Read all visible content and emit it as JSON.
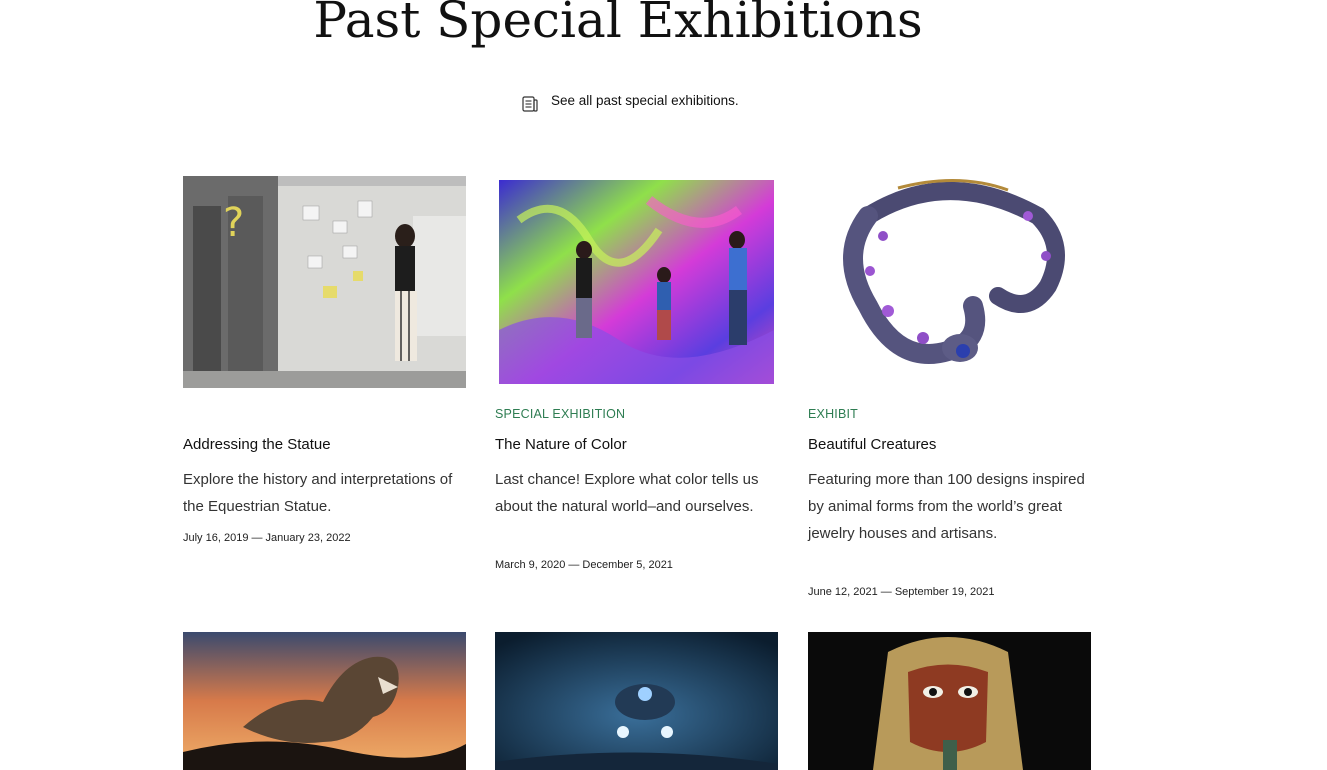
{
  "page": {
    "title": "Past Special Exhibitions"
  },
  "link": {
    "icon": "document-icon",
    "label": "See all past special exhibitions."
  },
  "cards": [
    {
      "tag": "",
      "title": "Addressing the Statue",
      "description": "Explore the history and interpretations of the Equestrian Statue.",
      "dates": "July 16, 2019 — January 23, 2022"
    },
    {
      "tag": "SPECIAL EXHIBITION",
      "title": "The Nature of Color",
      "description": "Last chance! Explore what color tells us about the natural world–and ourselves.",
      "dates": "March 9, 2020 — December 5, 2021"
    },
    {
      "tag": "EXHIBIT",
      "title": "Beautiful Creatures",
      "description": "Featuring more than 100 designs inspired by animal forms from the world’s great jewelry houses and artisans.",
      "dates": "June 12, 2021 — September 19, 2021"
    }
  ],
  "colors": {
    "tag": "#2e7d52",
    "text": "#111111"
  }
}
